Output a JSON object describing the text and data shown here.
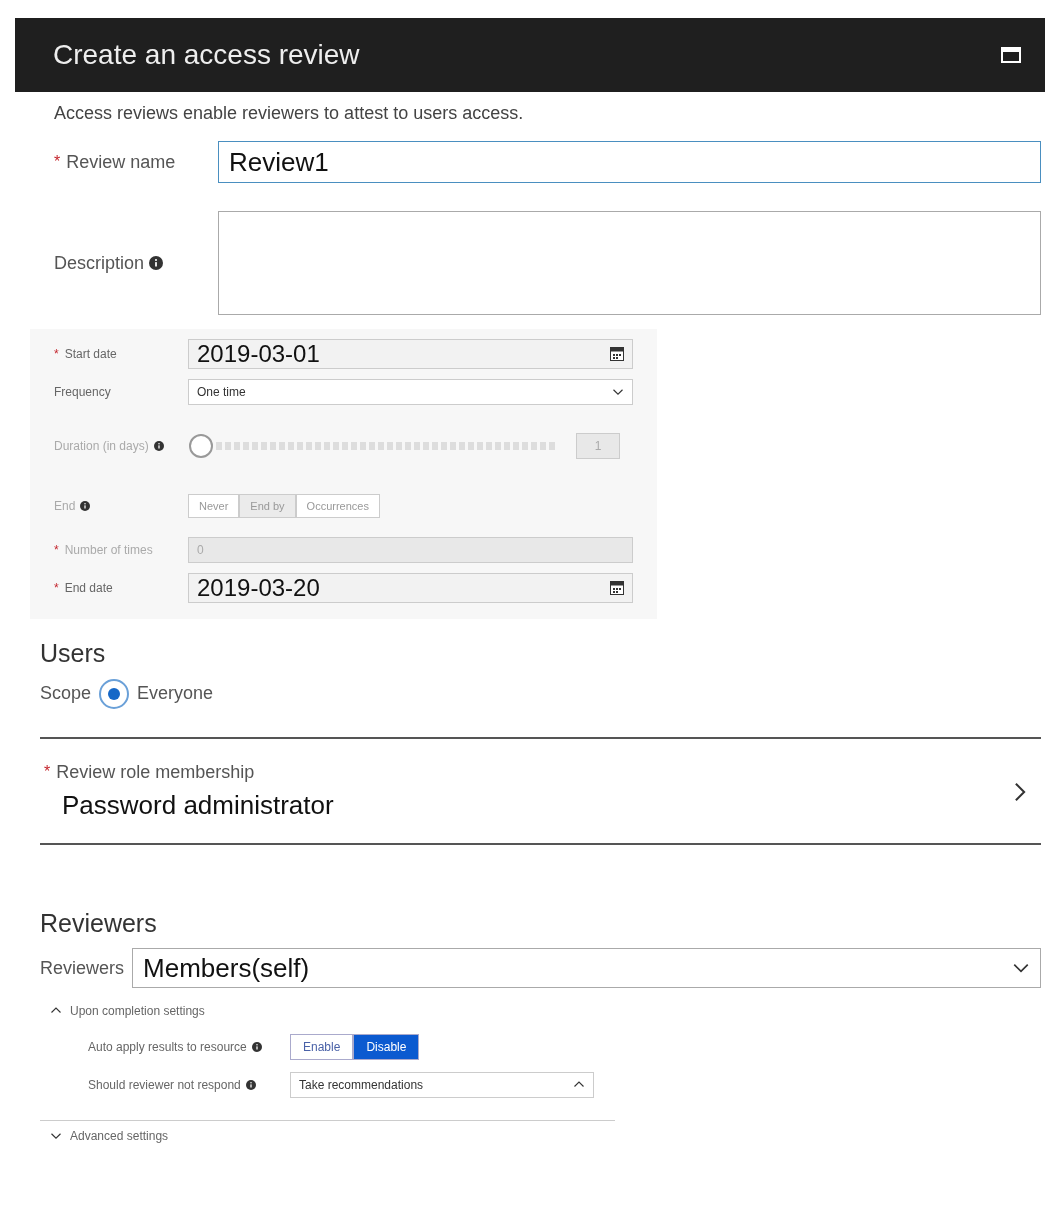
{
  "header": {
    "title": "Create an access review"
  },
  "intro": "Access reviews enable reviewers to attest to users access.",
  "review_name": {
    "label": "Review name",
    "required_mark": "*",
    "value": "Review1"
  },
  "description": {
    "label": "Description"
  },
  "schedule": {
    "start_date": {
      "label": "Start date",
      "required_mark": "*",
      "value": "2019-03-01"
    },
    "frequency": {
      "label": "Frequency",
      "value": "One time"
    },
    "duration": {
      "label": "Duration (in days)",
      "value": "1",
      "disabled": true
    },
    "end": {
      "label": "End",
      "options": [
        {
          "label": "Never",
          "selected": false
        },
        {
          "label": "End by",
          "selected": true
        },
        {
          "label": "Occurrences",
          "selected": false
        }
      ]
    },
    "number_of_times": {
      "label": "Number of times",
      "required_mark": "*",
      "value": "0",
      "disabled": true
    },
    "end_date": {
      "label": "End date",
      "required_mark": "*",
      "value": "2019-03-20"
    }
  },
  "users": {
    "heading": "Users",
    "scope_label": "Scope",
    "scope": {
      "label": "Everyone",
      "selected": true
    }
  },
  "role": {
    "label": "Review role membership",
    "required_mark": "*",
    "value": "Password administrator"
  },
  "reviewers": {
    "heading": "Reviewers",
    "label": "Reviewers",
    "value": "Members(self)"
  },
  "completion": {
    "label": "Upon completion settings",
    "expanded": true,
    "auto_apply": {
      "label": "Auto apply results to resource",
      "options": [
        {
          "label": "Enable",
          "selected": false
        },
        {
          "label": "Disable",
          "selected": true
        }
      ]
    },
    "no_response": {
      "label": "Should reviewer not respond",
      "value": "Take recommendations"
    }
  },
  "advanced": {
    "label": "Advanced settings",
    "expanded": false
  }
}
